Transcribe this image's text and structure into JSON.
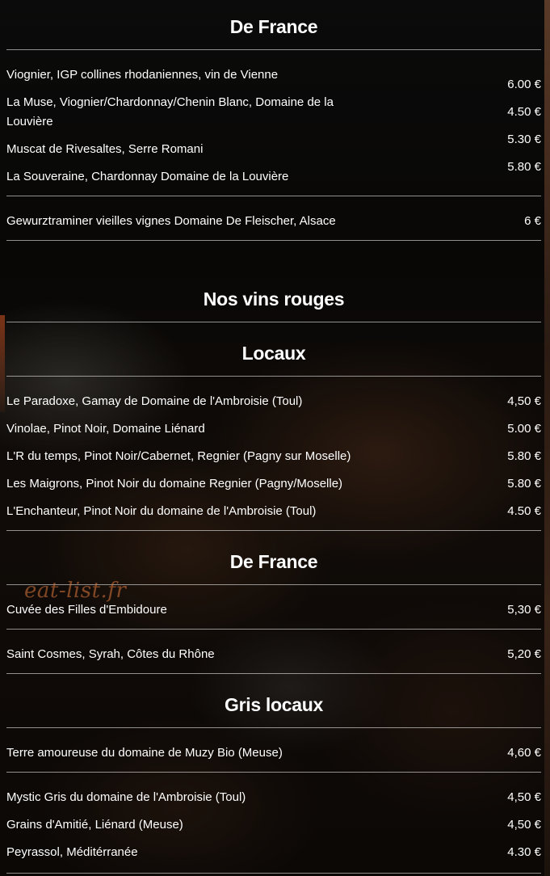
{
  "watermark": "eat-list.fr",
  "sections": {
    "de_france_blanc": {
      "title": "De France",
      "items": [
        {
          "name": "Viognier, IGP collines rhodaniennes, vin de Vienne",
          "price": "6.00 €"
        },
        {
          "name": "La Muse, Viognier/Chardonnay/Chenin Blanc, Domaine de la Louvière",
          "price": "4.50 €"
        },
        {
          "name": "Muscat de Rivesaltes, Serre Romani",
          "price": "5.30 €"
        },
        {
          "name": "La Souveraine, Chardonnay Domaine de la Louvière",
          "price": "5.80 €"
        }
      ],
      "extra": {
        "name": "Gewurztraminer vieilles vignes Domaine De Fleischer, Alsace",
        "price": "6 €"
      }
    },
    "rouges": {
      "title": "Nos vins rouges",
      "locaux": {
        "title": "Locaux",
        "items": [
          {
            "name": "Le Paradoxe, Gamay de Domaine de l'Ambroisie (Toul)",
            "price": "4,50 €"
          },
          {
            "name": "Vinolae, Pinot Noir, Domaine Liénard",
            "price": "5.00 €"
          },
          {
            "name": "L'R du temps, Pinot Noir/Cabernet, Regnier (Pagny sur Moselle)",
            "price": "5.80 €"
          },
          {
            "name": "Les Maigrons, Pinot Noir du domaine Regnier (Pagny/Moselle)",
            "price": "5.80 €"
          },
          {
            "name": "L'Enchanteur, Pinot Noir du domaine de l'Ambroisie (Toul)",
            "price": "4.50 €"
          }
        ]
      },
      "de_france": {
        "title": "De France",
        "items": [
          {
            "name": "Cuvée des Filles d'Embidoure",
            "price": "5,30 €"
          },
          {
            "name": "Saint Cosmes, Syrah, Côtes du Rhône",
            "price": "5,20 €"
          }
        ]
      }
    },
    "gris": {
      "title": "Gris locaux",
      "first": {
        "name": "Terre amoureuse du domaine de Muzy Bio (Meuse)",
        "price": "4,60 €"
      },
      "items": [
        {
          "name": "Mystic Gris du domaine de l'Ambroisie (Toul)",
          "price": "4,50 €"
        },
        {
          "name": "Grains d'Amitié, Liénard (Meuse)",
          "price": "4,50 €"
        },
        {
          "name": "Peyrassol, Méditérranée",
          "price": "4.30 €"
        }
      ]
    }
  }
}
